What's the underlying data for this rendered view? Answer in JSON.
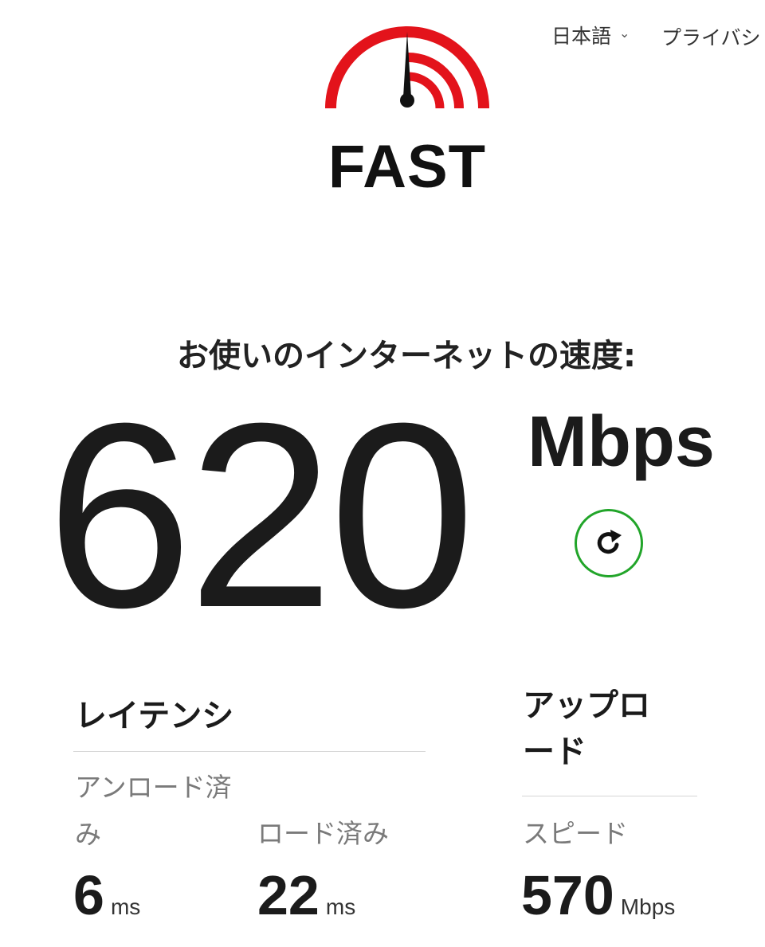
{
  "header": {
    "language": "日本語",
    "privacy": "プライバシ"
  },
  "logo": {
    "text": "FAST"
  },
  "main": {
    "heading": "お使いのインターネットの速度:",
    "speed": "620",
    "unit": "Mbps",
    "refresh_icon": "refresh-icon"
  },
  "latency": {
    "title": "レイテンシ",
    "unloaded_label_line1": "アンロード済",
    "unloaded_label_line2": "み",
    "unloaded_value": "6",
    "unloaded_unit": "ms",
    "loaded_label": "ロード済み",
    "loaded_value": "22",
    "loaded_unit": "ms"
  },
  "upload": {
    "title_line1": "アップロ",
    "title_line2": "ード",
    "speed_label": "スピード",
    "value": "570",
    "unit": "Mbps"
  },
  "colors": {
    "accent_red": "#e3131b",
    "refresh_green": "#22a52a",
    "text_dark": "#1b1b1b",
    "text_muted": "#7a7a7a"
  }
}
